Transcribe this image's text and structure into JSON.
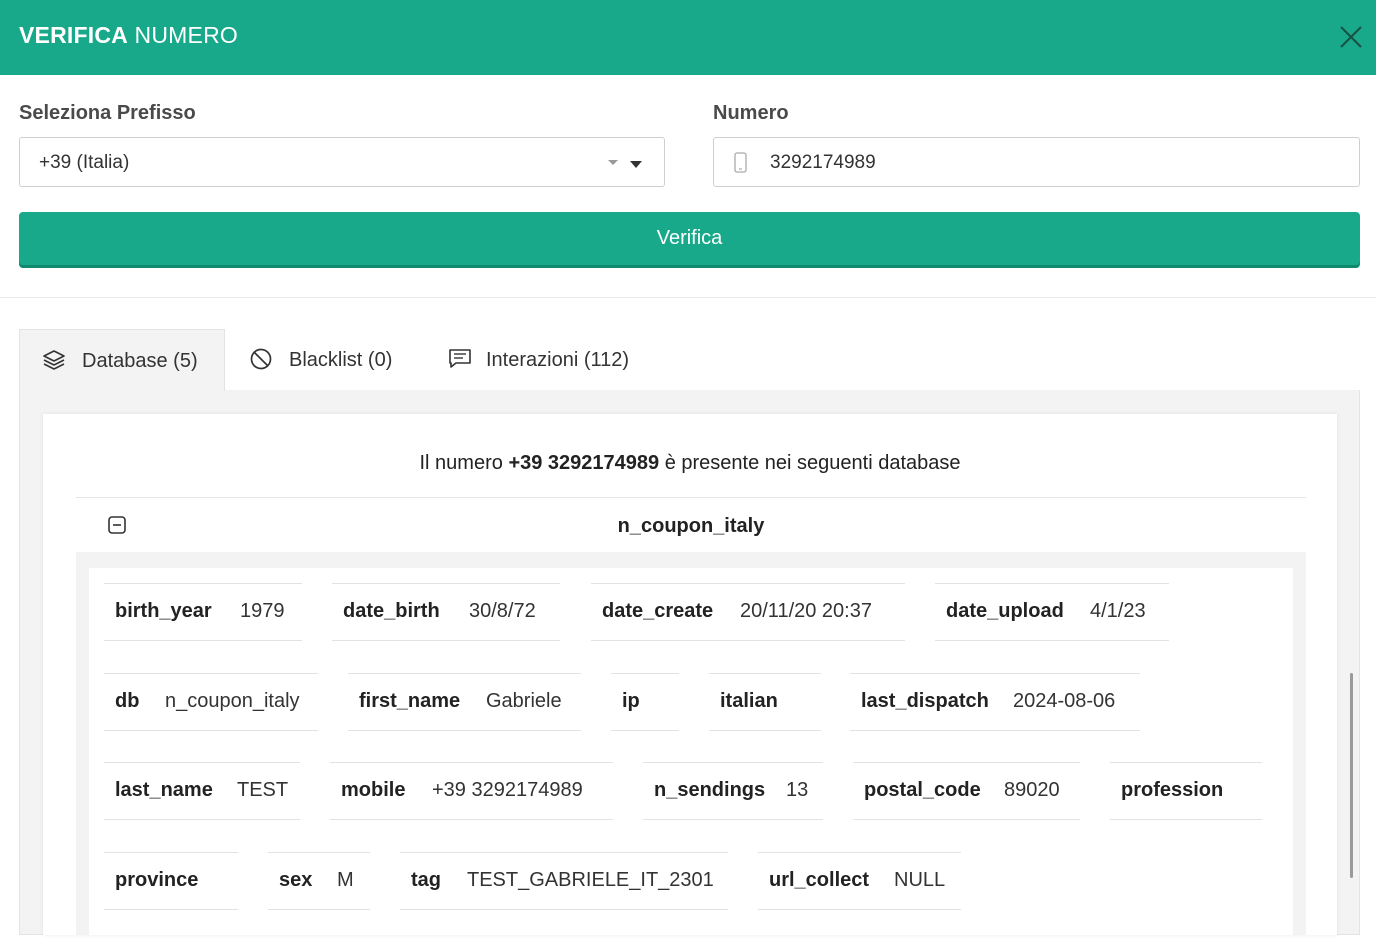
{
  "header": {
    "title_bold": "VERIFICA",
    "title_light": "NUMERO"
  },
  "form": {
    "prefix_label": "Seleziona Prefisso",
    "prefix_value": "+39 (Italia)",
    "number_label": "Numero",
    "number_value": "3292174989",
    "verify_label": "Verifica"
  },
  "tabs": [
    {
      "label": "Database (5)",
      "icon": "layers-icon"
    },
    {
      "label": "Blacklist (0)",
      "icon": "block-icon"
    },
    {
      "label": "Interazioni (112)",
      "icon": "message-icon"
    }
  ],
  "result": {
    "prefix_text": "Il numero",
    "number_bold": "+39 3292174989",
    "suffix_text": "è presente nei seguenti database",
    "db_name": "n_coupon_italy"
  },
  "fields": [
    {
      "key": "birth_year",
      "value": "1979"
    },
    {
      "key": "date_birth",
      "value": "30/8/72"
    },
    {
      "key": "date_create",
      "value": "20/11/20 20:37"
    },
    {
      "key": "date_upload",
      "value": "4/1/23"
    },
    {
      "key": "db",
      "value": "n_coupon_italy"
    },
    {
      "key": "first_name",
      "value": "Gabriele"
    },
    {
      "key": "ip",
      "value": ""
    },
    {
      "key": "italian",
      "value": ""
    },
    {
      "key": "last_dispatch",
      "value": "2024-08-06"
    },
    {
      "key": "last_name",
      "value": "TEST"
    },
    {
      "key": "mobile",
      "value": "+39 3292174989"
    },
    {
      "key": "n_sendings",
      "value": "13"
    },
    {
      "key": "postal_code",
      "value": "89020"
    },
    {
      "key": "profession",
      "value": ""
    },
    {
      "key": "province",
      "value": ""
    },
    {
      "key": "sex",
      "value": "M"
    },
    {
      "key": "tag",
      "value": "TEST_GABRIELE_IT_2301"
    },
    {
      "key": "url_collect",
      "value": "NULL"
    }
  ],
  "colors": {
    "accent": "#17a98a",
    "panel_bg": "#f3f3f3"
  }
}
